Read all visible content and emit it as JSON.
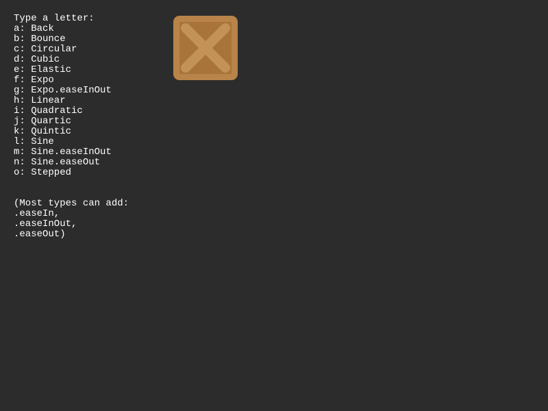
{
  "header": "Type a letter:",
  "options": [
    "a: Back",
    "b: Bounce",
    "c: Circular",
    "d: Cubic",
    "e: Elastic",
    "f: Expo",
    "g: Expo.easeInOut",
    "h: Linear",
    "i: Quadratic",
    "j: Quartic",
    "k: Quintic",
    "l: Sine",
    "m: Sine.easeInOut",
    "n: Sine.easeOut",
    "o: Stepped"
  ],
  "note": [
    "(Most types can add:",
    ".easeIn,",
    ".easeInOut,",
    ".easeOut)"
  ],
  "sprite": {
    "name": "crate-icon",
    "colors": {
      "outer": "#b88449",
      "inner": "#a87439",
      "cross": "#c29257"
    }
  },
  "background": "#2c2c2c",
  "text_color": "#ffffff"
}
